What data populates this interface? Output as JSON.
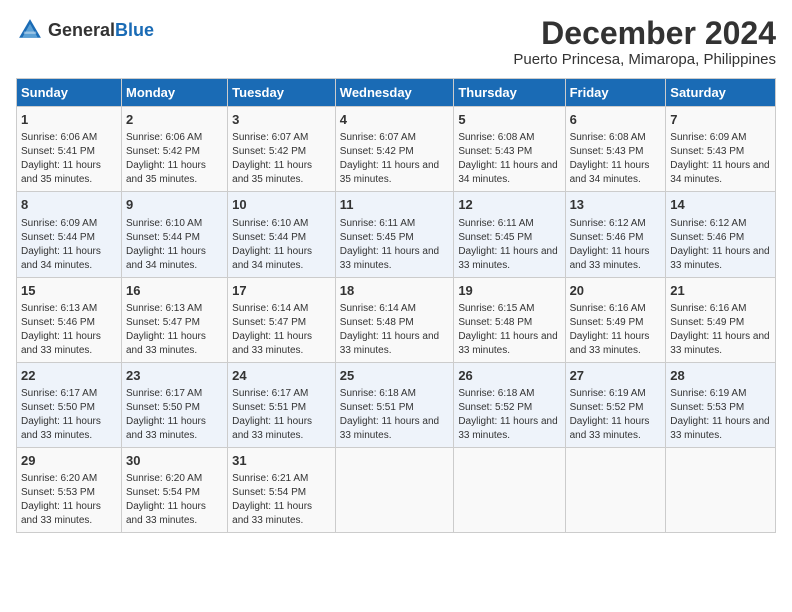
{
  "header": {
    "logo_general": "General",
    "logo_blue": "Blue",
    "title": "December 2024",
    "subtitle": "Puerto Princesa, Mimaropa, Philippines"
  },
  "days_of_week": [
    "Sunday",
    "Monday",
    "Tuesday",
    "Wednesday",
    "Thursday",
    "Friday",
    "Saturday"
  ],
  "weeks": [
    [
      {
        "day": "1",
        "sunrise": "Sunrise: 6:06 AM",
        "sunset": "Sunset: 5:41 PM",
        "daylight": "Daylight: 11 hours and 35 minutes."
      },
      {
        "day": "2",
        "sunrise": "Sunrise: 6:06 AM",
        "sunset": "Sunset: 5:42 PM",
        "daylight": "Daylight: 11 hours and 35 minutes."
      },
      {
        "day": "3",
        "sunrise": "Sunrise: 6:07 AM",
        "sunset": "Sunset: 5:42 PM",
        "daylight": "Daylight: 11 hours and 35 minutes."
      },
      {
        "day": "4",
        "sunrise": "Sunrise: 6:07 AM",
        "sunset": "Sunset: 5:42 PM",
        "daylight": "Daylight: 11 hours and 35 minutes."
      },
      {
        "day": "5",
        "sunrise": "Sunrise: 6:08 AM",
        "sunset": "Sunset: 5:43 PM",
        "daylight": "Daylight: 11 hours and 34 minutes."
      },
      {
        "day": "6",
        "sunrise": "Sunrise: 6:08 AM",
        "sunset": "Sunset: 5:43 PM",
        "daylight": "Daylight: 11 hours and 34 minutes."
      },
      {
        "day": "7",
        "sunrise": "Sunrise: 6:09 AM",
        "sunset": "Sunset: 5:43 PM",
        "daylight": "Daylight: 11 hours and 34 minutes."
      }
    ],
    [
      {
        "day": "8",
        "sunrise": "Sunrise: 6:09 AM",
        "sunset": "Sunset: 5:44 PM",
        "daylight": "Daylight: 11 hours and 34 minutes."
      },
      {
        "day": "9",
        "sunrise": "Sunrise: 6:10 AM",
        "sunset": "Sunset: 5:44 PM",
        "daylight": "Daylight: 11 hours and 34 minutes."
      },
      {
        "day": "10",
        "sunrise": "Sunrise: 6:10 AM",
        "sunset": "Sunset: 5:44 PM",
        "daylight": "Daylight: 11 hours and 34 minutes."
      },
      {
        "day": "11",
        "sunrise": "Sunrise: 6:11 AM",
        "sunset": "Sunset: 5:45 PM",
        "daylight": "Daylight: 11 hours and 33 minutes."
      },
      {
        "day": "12",
        "sunrise": "Sunrise: 6:11 AM",
        "sunset": "Sunset: 5:45 PM",
        "daylight": "Daylight: 11 hours and 33 minutes."
      },
      {
        "day": "13",
        "sunrise": "Sunrise: 6:12 AM",
        "sunset": "Sunset: 5:46 PM",
        "daylight": "Daylight: 11 hours and 33 minutes."
      },
      {
        "day": "14",
        "sunrise": "Sunrise: 6:12 AM",
        "sunset": "Sunset: 5:46 PM",
        "daylight": "Daylight: 11 hours and 33 minutes."
      }
    ],
    [
      {
        "day": "15",
        "sunrise": "Sunrise: 6:13 AM",
        "sunset": "Sunset: 5:46 PM",
        "daylight": "Daylight: 11 hours and 33 minutes."
      },
      {
        "day": "16",
        "sunrise": "Sunrise: 6:13 AM",
        "sunset": "Sunset: 5:47 PM",
        "daylight": "Daylight: 11 hours and 33 minutes."
      },
      {
        "day": "17",
        "sunrise": "Sunrise: 6:14 AM",
        "sunset": "Sunset: 5:47 PM",
        "daylight": "Daylight: 11 hours and 33 minutes."
      },
      {
        "day": "18",
        "sunrise": "Sunrise: 6:14 AM",
        "sunset": "Sunset: 5:48 PM",
        "daylight": "Daylight: 11 hours and 33 minutes."
      },
      {
        "day": "19",
        "sunrise": "Sunrise: 6:15 AM",
        "sunset": "Sunset: 5:48 PM",
        "daylight": "Daylight: 11 hours and 33 minutes."
      },
      {
        "day": "20",
        "sunrise": "Sunrise: 6:16 AM",
        "sunset": "Sunset: 5:49 PM",
        "daylight": "Daylight: 11 hours and 33 minutes."
      },
      {
        "day": "21",
        "sunrise": "Sunrise: 6:16 AM",
        "sunset": "Sunset: 5:49 PM",
        "daylight": "Daylight: 11 hours and 33 minutes."
      }
    ],
    [
      {
        "day": "22",
        "sunrise": "Sunrise: 6:17 AM",
        "sunset": "Sunset: 5:50 PM",
        "daylight": "Daylight: 11 hours and 33 minutes."
      },
      {
        "day": "23",
        "sunrise": "Sunrise: 6:17 AM",
        "sunset": "Sunset: 5:50 PM",
        "daylight": "Daylight: 11 hours and 33 minutes."
      },
      {
        "day": "24",
        "sunrise": "Sunrise: 6:17 AM",
        "sunset": "Sunset: 5:51 PM",
        "daylight": "Daylight: 11 hours and 33 minutes."
      },
      {
        "day": "25",
        "sunrise": "Sunrise: 6:18 AM",
        "sunset": "Sunset: 5:51 PM",
        "daylight": "Daylight: 11 hours and 33 minutes."
      },
      {
        "day": "26",
        "sunrise": "Sunrise: 6:18 AM",
        "sunset": "Sunset: 5:52 PM",
        "daylight": "Daylight: 11 hours and 33 minutes."
      },
      {
        "day": "27",
        "sunrise": "Sunrise: 6:19 AM",
        "sunset": "Sunset: 5:52 PM",
        "daylight": "Daylight: 11 hours and 33 minutes."
      },
      {
        "day": "28",
        "sunrise": "Sunrise: 6:19 AM",
        "sunset": "Sunset: 5:53 PM",
        "daylight": "Daylight: 11 hours and 33 minutes."
      }
    ],
    [
      {
        "day": "29",
        "sunrise": "Sunrise: 6:20 AM",
        "sunset": "Sunset: 5:53 PM",
        "daylight": "Daylight: 11 hours and 33 minutes."
      },
      {
        "day": "30",
        "sunrise": "Sunrise: 6:20 AM",
        "sunset": "Sunset: 5:54 PM",
        "daylight": "Daylight: 11 hours and 33 minutes."
      },
      {
        "day": "31",
        "sunrise": "Sunrise: 6:21 AM",
        "sunset": "Sunset: 5:54 PM",
        "daylight": "Daylight: 11 hours and 33 minutes."
      },
      null,
      null,
      null,
      null
    ]
  ]
}
